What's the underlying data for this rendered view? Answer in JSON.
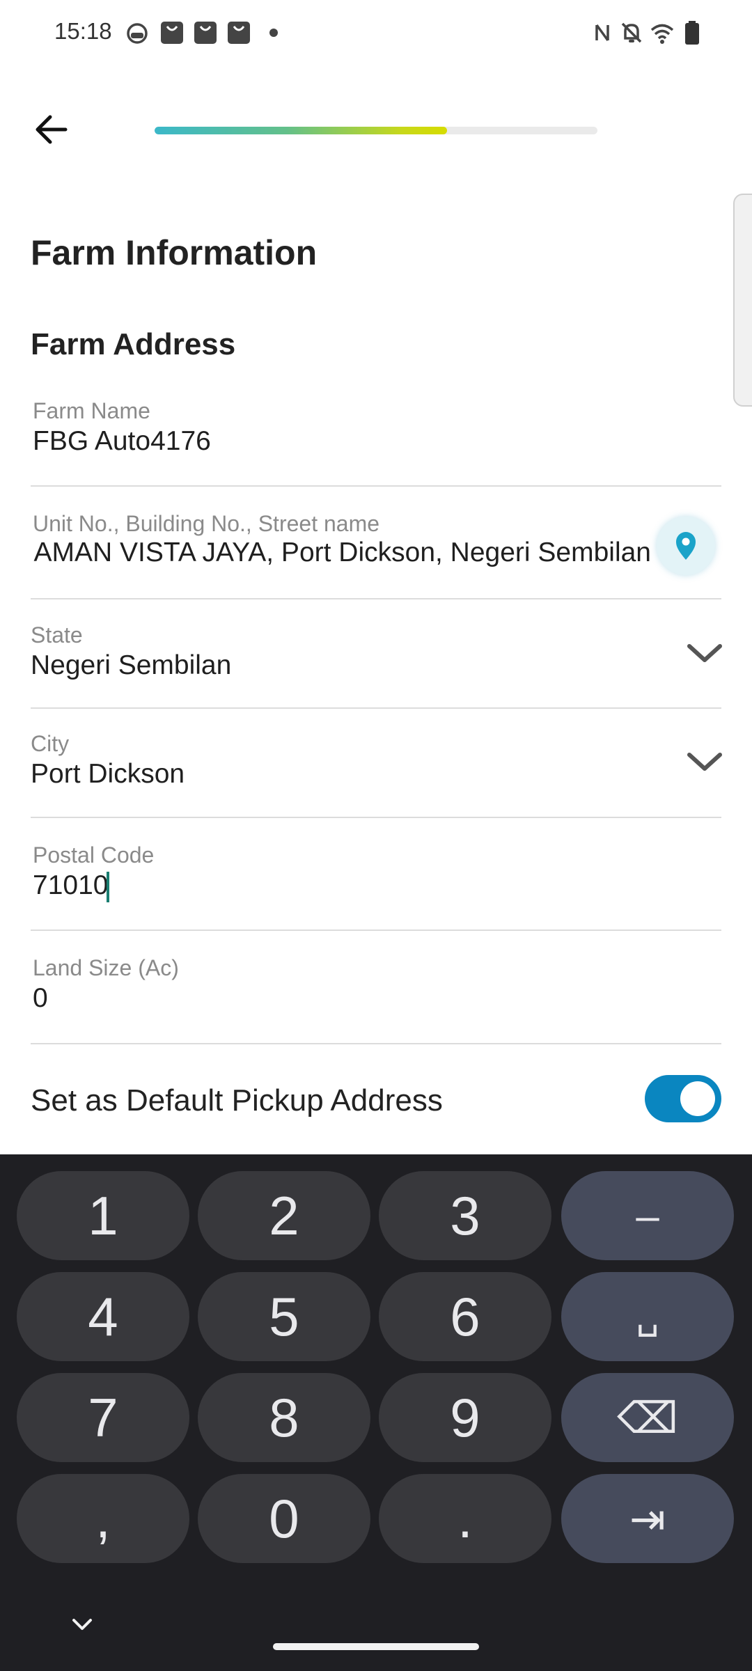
{
  "status_bar": {
    "time": "15:18",
    "left_icons": [
      "android-icon",
      "shopping-bag-icon",
      "shopping-bag-icon",
      "shopping-bag-icon",
      "dot-icon"
    ],
    "right_icons": [
      "nfc-icon",
      "bell-off-icon",
      "wifi-icon",
      "battery-icon"
    ]
  },
  "header": {
    "progress": 0.66,
    "progress_colors": [
      "#3bb8c9",
      "#d6dc00"
    ]
  },
  "page_title": "Farm Information",
  "section_title": "Farm Address",
  "fields": {
    "farm_name": {
      "label": "Farm Name",
      "value": "FBG Auto4176"
    },
    "address": {
      "label": "Unit No., Building No., Street name",
      "value": "AMAN VISTA JAYA, Port Dickson, Negeri Sembilan"
    },
    "state": {
      "label": "State",
      "value": "Negeri Sembilan"
    },
    "city": {
      "label": "City",
      "value": "Port Dickson"
    },
    "postal_code": {
      "label": "Postal Code",
      "value": "71010"
    },
    "land_size": {
      "label": "Land Size (Ac)",
      "value": "0"
    }
  },
  "default_pickup": {
    "label": "Set as Default Pickup Address",
    "enabled": true
  },
  "keyboard": {
    "rows": [
      [
        "1",
        "2",
        "3",
        "–"
      ],
      [
        "4",
        "5",
        "6",
        "␣"
      ],
      [
        "7",
        "8",
        "9",
        "⌫"
      ],
      [
        ",",
        "0",
        ".",
        "⇥"
      ]
    ]
  },
  "colors": {
    "accent": "#0a86c0",
    "location_pin": "#1aa3c9",
    "keyboard_bg": "#1f1f23",
    "key_bg": "#38383c",
    "func_key_bg": "#464b5c"
  }
}
